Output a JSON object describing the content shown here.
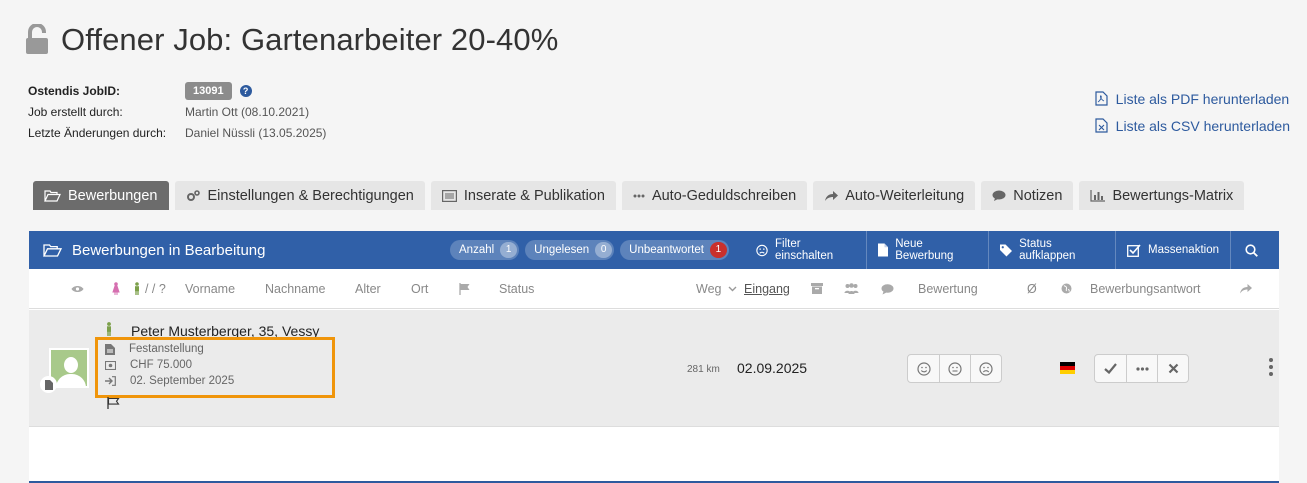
{
  "page": {
    "title": "Offener Job: Gartenarbeiter 20-40%"
  },
  "meta": {
    "jobid_label": "Ostendis JobID:",
    "jobid_value": "13091",
    "help": "?",
    "created_label": "Job erstellt durch:",
    "created_value": "Martin Ott (08.10.2021)",
    "changed_label": "Letzte Änderungen durch:",
    "changed_value": "Daniel Nüssli (13.05.2025)"
  },
  "downloads": {
    "pdf": "Liste als PDF herunterladen",
    "csv": "Liste als CSV herunterladen"
  },
  "tabs": [
    {
      "label": "Bewerbungen",
      "icon": "folder-open-icon",
      "active": true
    },
    {
      "label": "Einstellungen & Berechtigungen",
      "icon": "cogs-icon"
    },
    {
      "label": "Inserate & Publikation",
      "icon": "list-icon"
    },
    {
      "label": "Auto-Geduldschreiben",
      "icon": "ellipsis-icon"
    },
    {
      "label": "Auto-Weiterleitung",
      "icon": "share-icon"
    },
    {
      "label": "Notizen",
      "icon": "comment-icon"
    },
    {
      "label": "Bewertungs-Matrix",
      "icon": "bar-chart-icon"
    }
  ],
  "panel": {
    "title": "Bewerbungen in Bearbeitung",
    "counters": [
      {
        "label": "Anzahl",
        "value": "1"
      },
      {
        "label": "Ungelesen",
        "value": "0"
      },
      {
        "label": "Unbeantwortet",
        "value": "1"
      }
    ],
    "actions": {
      "filter": "Filter einschalten",
      "new": "Neue Bewerbung",
      "status": "Status aufklappen",
      "mass": "Massenaktion"
    }
  },
  "columns": {
    "gender": "/ / ?",
    "vorname": "Vorname",
    "nachname": "Nachname",
    "alter": "Alter",
    "ort": "Ort",
    "status": "Status",
    "weg": "Weg",
    "eingang": "Eingang",
    "bewertung": "Bewertung",
    "avg": "Ø",
    "antwort": "Bewerbungsantwort"
  },
  "application": {
    "name": "Peter Musterberger, 35, Vessy",
    "employment": "Festanstellung",
    "salary": "CHF 75.000",
    "start": "02. September 2025",
    "distance": "281 km",
    "date": "02.09.2025"
  },
  "colors": {
    "accent": "#3060a8",
    "highlight": "#f0950a",
    "badge_red": "#c9302c"
  }
}
